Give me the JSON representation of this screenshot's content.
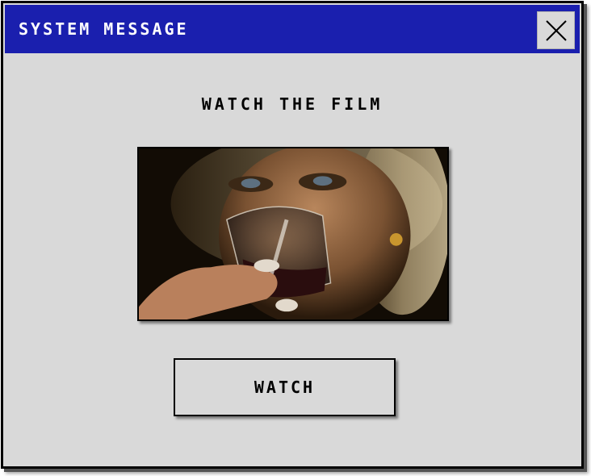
{
  "dialog": {
    "title": "SYSTEM MESSAGE",
    "heading": "WATCH THE FILM",
    "action_label": "WATCH",
    "close_icon": "close-icon",
    "image_description_icon": "film-still-image"
  },
  "colors": {
    "titlebar": "#1a1fae",
    "window_bg": "#d9d9d9",
    "border": "#000000",
    "title_text": "#ffffff"
  }
}
